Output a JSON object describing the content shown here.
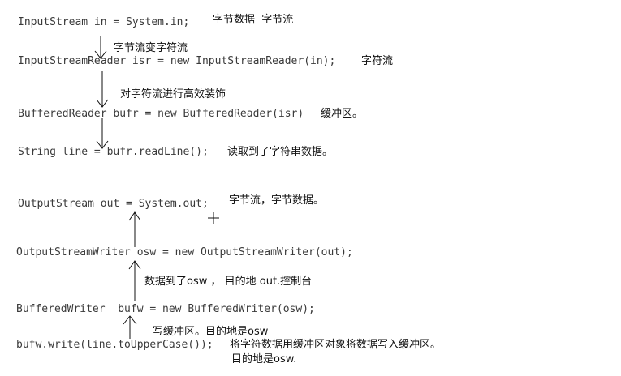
{
  "input_section": {
    "line1_code": "InputStream in = System.in;",
    "line1_note": "字节数据  字节流",
    "arrow1_note": "字节流变字符流",
    "line2_code": "InputStreamReader isr = new InputStreamReader(in);",
    "line2_note": "字符流",
    "arrow2_note": "对字符流进行高效装饰",
    "line3_code": "BufferedReader bufr = new BufferedReader(isr)",
    "line3_note": "缓冲区。",
    "line4_code": "String line = bufr.readLine();",
    "line4_note": "读取到了字符串数据。"
  },
  "output_section": {
    "line1_code": "OutputStream out = System.out;",
    "line1_note": "字节流，字节数据。",
    "line2_code": "OutputStreamWriter osw = new OutputStreamWriter(out);",
    "arrow1_note": "数据到了osw ， 目的地 out.控制台",
    "line3_code": "BufferedWriter  bufw = new BufferedWriter(osw);",
    "arrow2_note": "写缓冲区。目的地是osw",
    "line4_code": "bufw.write(line.toUpperCase());",
    "line4_note": "将字符数据用缓冲区对象将数据写入缓冲区。",
    "line4_note2": "目的地是osw."
  }
}
